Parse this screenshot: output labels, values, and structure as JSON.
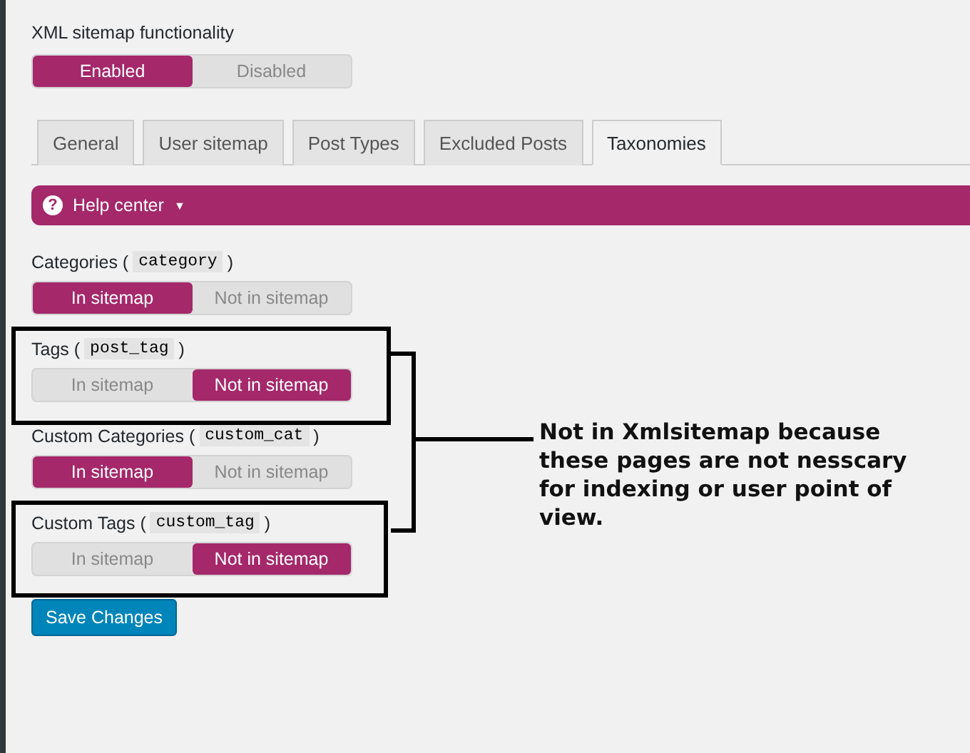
{
  "functionality": {
    "label": "XML sitemap functionality",
    "options": [
      {
        "label": "Enabled",
        "selected": true
      },
      {
        "label": "Disabled",
        "selected": false
      }
    ]
  },
  "tabs": [
    {
      "label": "General",
      "selected": false
    },
    {
      "label": "User sitemap",
      "selected": false
    },
    {
      "label": "Post Types",
      "selected": false
    },
    {
      "label": "Excluded Posts",
      "selected": false
    },
    {
      "label": "Taxonomies",
      "selected": true
    }
  ],
  "help_center": {
    "label": "Help center",
    "icon": "?",
    "caret": "▼"
  },
  "taxonomies": [
    {
      "label": "Categories (",
      "slug": "category",
      "close": ")",
      "options": [
        {
          "label": "In sitemap",
          "selected": true
        },
        {
          "label": "Not in sitemap",
          "selected": false
        }
      ]
    },
    {
      "label": "Tags (",
      "slug": "post_tag",
      "close": ")",
      "options": [
        {
          "label": "In sitemap",
          "selected": false
        },
        {
          "label": "Not in sitemap",
          "selected": true
        }
      ]
    },
    {
      "label": "Custom Categories (",
      "slug": "custom_cat",
      "close": ")",
      "options": [
        {
          "label": "In sitemap",
          "selected": true
        },
        {
          "label": "Not in sitemap",
          "selected": false
        }
      ]
    },
    {
      "label": "Custom Tags (",
      "slug": "custom_tag",
      "close": ")",
      "options": [
        {
          "label": "In sitemap",
          "selected": false
        },
        {
          "label": "Not in sitemap",
          "selected": true
        }
      ]
    }
  ],
  "save_button": "Save Changes",
  "annotation": {
    "note": "Not in Xmlsitemap because these pages are not nesscary for indexing or user point of view."
  }
}
